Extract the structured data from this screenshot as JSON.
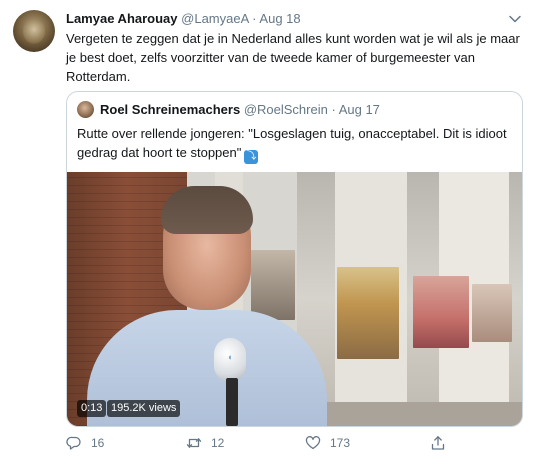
{
  "tweet": {
    "author_name": "Lamyae Aharouay",
    "author_handle": "@LamyaeA",
    "separator": "·",
    "date": "Aug 18",
    "text": "Vergeten te zeggen dat je in Nederland alles kunt worden wat je wil als je maar je best doet, zelfs voorzitter van de tweede kamer of burgemeester van Rotterdam."
  },
  "quoted_tweet": {
    "author_name": "Roel Schreinemachers",
    "author_handle": "@RoelSchrein",
    "separator": "·",
    "date": "Aug 17",
    "text": "Rutte over rellende jongeren: \"Losgeslagen tuig, onacceptabel. Dit is idioot gedrag dat hoort te stoppen\"",
    "emoji": "⤵",
    "video": {
      "duration": "0:13",
      "views": "195.2K views"
    }
  },
  "actions": {
    "replies": "16",
    "retweets": "12",
    "likes": "173"
  },
  "icons": {
    "reply": "reply-icon",
    "retweet": "retweet-icon",
    "like": "heart-icon",
    "share": "share-icon",
    "menu": "chevron-down-icon"
  },
  "colors": {
    "text": "#14171a",
    "secondary": "#657786",
    "border": "#ccd6dd",
    "emoji_bg": "#3b94d9"
  }
}
